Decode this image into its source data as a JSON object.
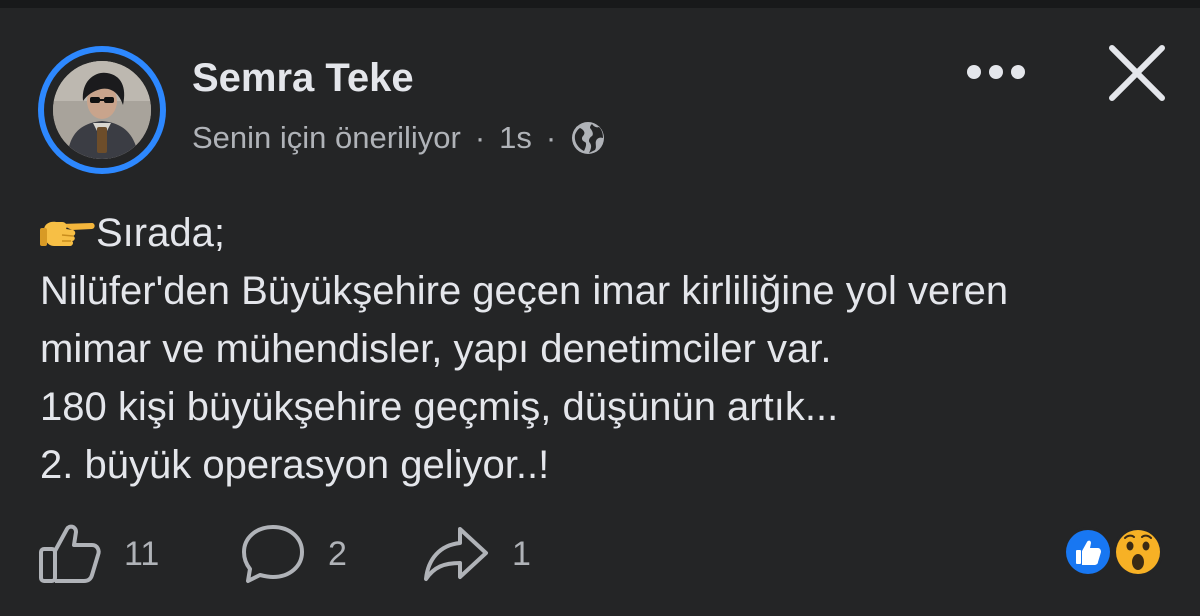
{
  "post": {
    "author": {
      "name": "Semra Teke",
      "avatar_icon": "profile-photo"
    },
    "meta": {
      "suggestion": "Senin için öneriliyor",
      "separator": "·",
      "time": "1s",
      "audience_icon": "globe-icon"
    },
    "header_actions": {
      "more_icon": "more-horizontal-icon",
      "close_icon": "close-icon"
    },
    "text": {
      "emoji": "backhand-index-pointing-right",
      "lines": [
        "Sırada;",
        "Nilüfer'den Büyükşehire geçen imar kirliliğine yol veren",
        "mimar ve mühendisler, yapı denetimciler var.",
        "180 kişi büyükşehire geçmiş, düşünün artık...",
        "2. büyük operasyon geliyor..!"
      ]
    },
    "actions": {
      "like": {
        "icon": "thumbs-up-icon",
        "count": "11"
      },
      "comment": {
        "icon": "comment-icon",
        "count": "2"
      },
      "share": {
        "icon": "share-arrow-icon",
        "count": "1"
      }
    },
    "reactions": [
      "like-reaction",
      "wow-reaction"
    ],
    "colors": {
      "background": "#242526",
      "accent": "#2d88ff",
      "primary_text": "#e4e6eb",
      "secondary_text": "#b0b3b8",
      "wow_yellow": "#f7b125"
    }
  }
}
